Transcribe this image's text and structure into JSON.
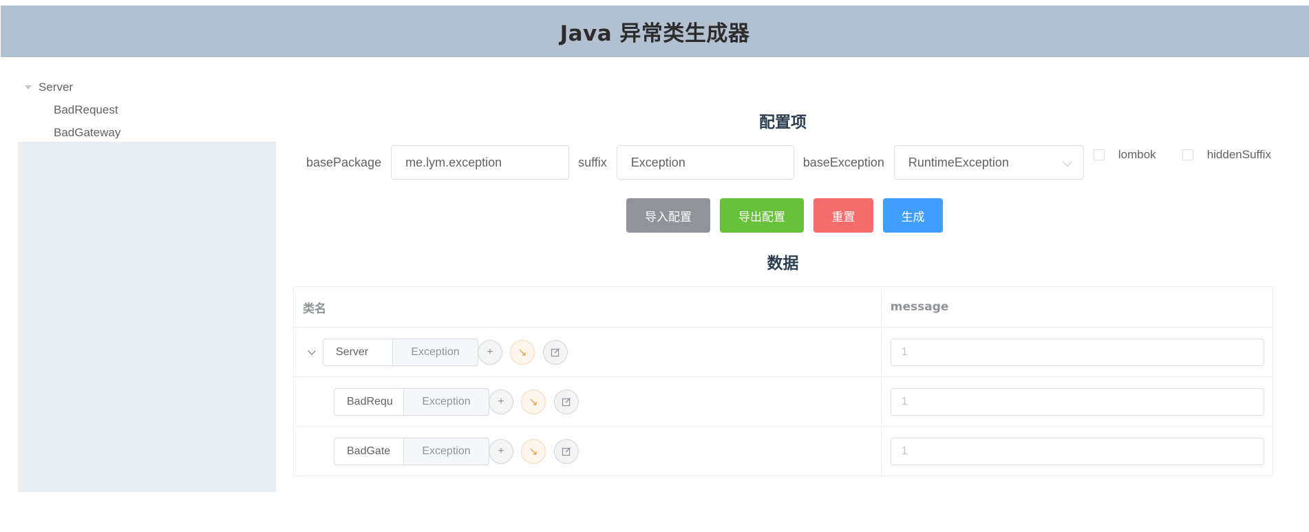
{
  "header": {
    "title": "Java 异常类生成器"
  },
  "tree": {
    "root": "Server",
    "children": [
      "BadRequest",
      "BadGateway"
    ]
  },
  "config": {
    "title": "配置项",
    "basePackage_label": "basePackage",
    "basePackage_value": "me.lym.exception",
    "suffix_label": "suffix",
    "suffix_value": "Exception",
    "baseException_label": "baseException",
    "baseException_value": "RuntimeException",
    "lombok_label": "lombok",
    "hiddenSuffix_label": "hiddenSuffix"
  },
  "buttons": {
    "import": "导入配置",
    "export": "导出配置",
    "reset": "重置",
    "generate": "生成"
  },
  "data_section": {
    "title": "数据",
    "columns": [
      "类名",
      "message"
    ],
    "rows": [
      {
        "name": "Server",
        "suffix": "Exception",
        "message": "1"
      },
      {
        "name": "BadRequ",
        "suffix": "Exception",
        "message": "1"
      },
      {
        "name": "BadGate",
        "suffix": "Exception",
        "message": "1"
      }
    ]
  },
  "icons": {
    "add": "plus-icon",
    "move": "arrow-down-right-icon",
    "edit": "edit-icon"
  },
  "colors": {
    "header_bg": "#b3c0d1",
    "sidebar_bg": "#e9eef3",
    "btn_gray": "#909399",
    "btn_green": "#67c23a",
    "btn_red": "#f56c6c",
    "btn_blue": "#409eff"
  }
}
